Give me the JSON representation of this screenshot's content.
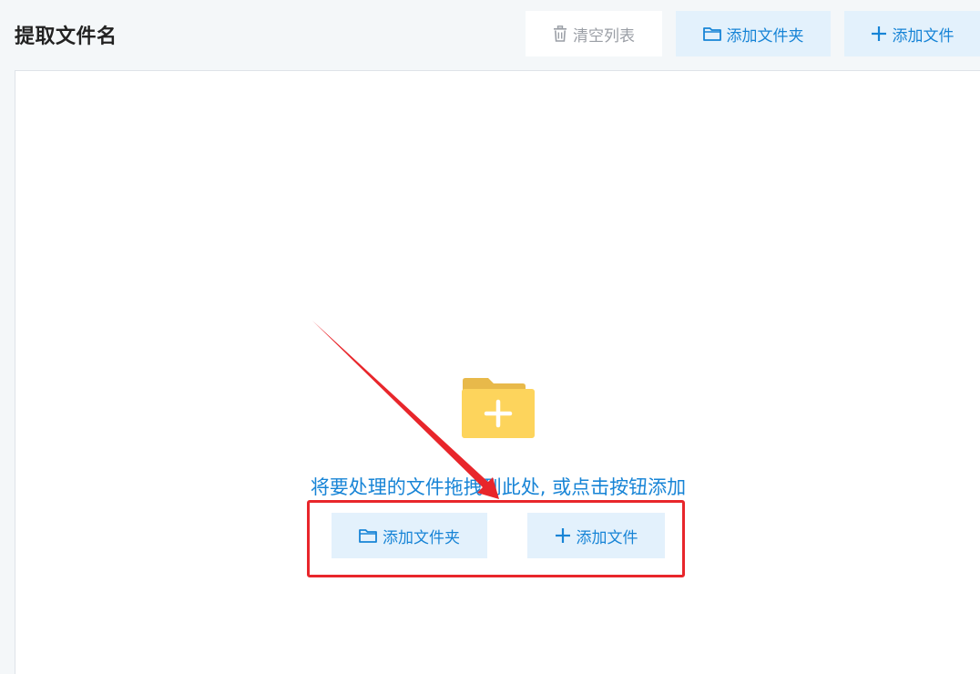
{
  "page": {
    "title": "提取文件名"
  },
  "toolbar": {
    "clear_label": "清空列表",
    "add_folder_label": "添加文件夹",
    "add_file_label": "添加文件"
  },
  "drop_area": {
    "hint": "将要处理的文件拖拽到此处, 或点击按钮添加",
    "add_folder_label": "添加文件夹",
    "add_file_label": "添加文件"
  },
  "icons": {
    "clear": "trash-icon",
    "folder": "folder-icon",
    "plus": "plus-icon",
    "drop": "folder-plus-icon"
  },
  "colors": {
    "accent": "#1784d6",
    "button_bg": "#e3f1fc",
    "disabled_text": "#9a9ea5",
    "folder_yellow": "#fdd45c",
    "highlight_red": "#e8262b"
  }
}
